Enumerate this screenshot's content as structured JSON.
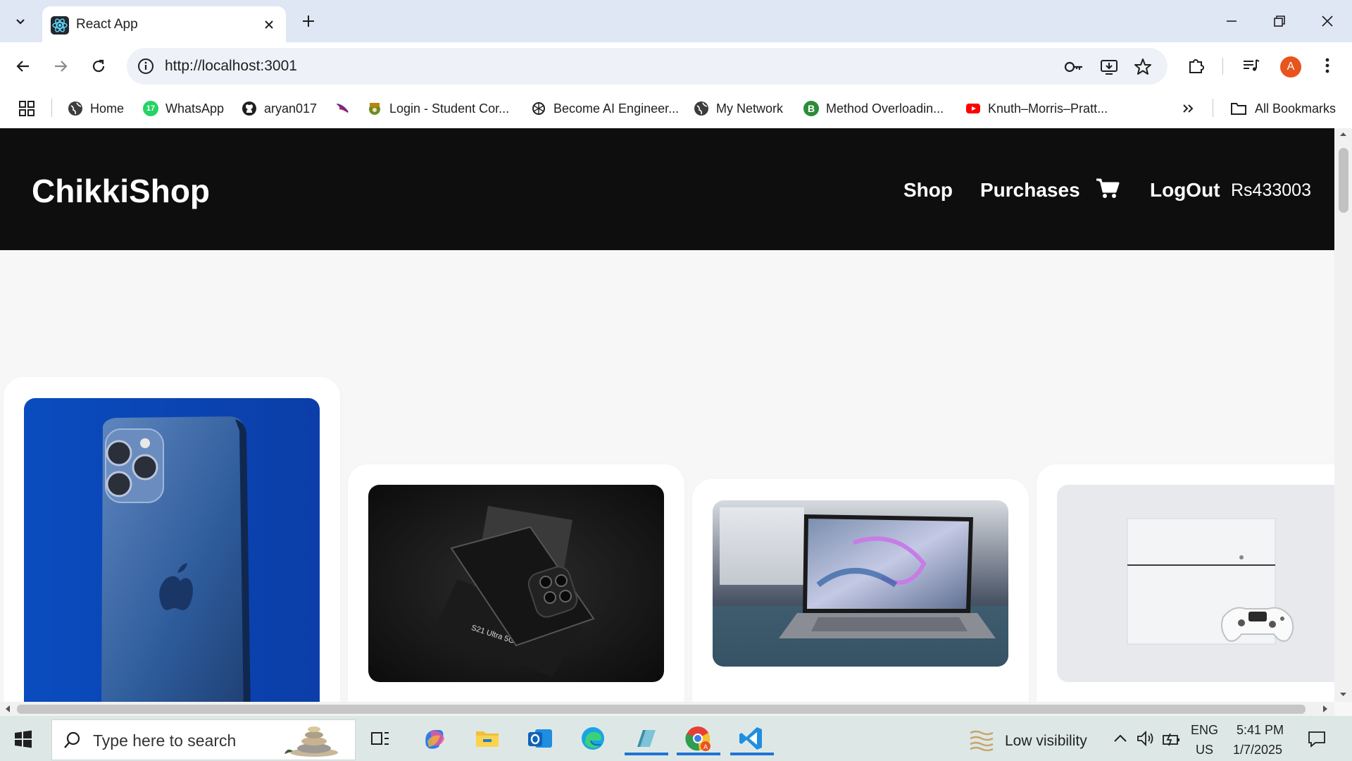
{
  "browser": {
    "tab_title": "React App",
    "url": "http://localhost:3001",
    "profile_initial": "A",
    "bookmarks": [
      {
        "label": "Home",
        "icon": "globe-icon"
      },
      {
        "label": "WhatsApp",
        "icon": "whatsapp-icon",
        "badge": "17"
      },
      {
        "label": "aryan017",
        "icon": "github-icon"
      },
      {
        "label": "",
        "icon": "bird-logo-icon"
      },
      {
        "label": "Login - Student Cor...",
        "icon": "student-portal-icon"
      },
      {
        "label": "Become AI Engineer...",
        "icon": "openai-icon"
      },
      {
        "label": "My Network",
        "icon": "globe-icon"
      },
      {
        "label": "Method Overloadin...",
        "icon": "b-logo-icon"
      },
      {
        "label": "Knuth–Morris–Pratt...",
        "icon": "youtube-icon"
      }
    ],
    "all_bookmarks_label": "All Bookmarks"
  },
  "app": {
    "brand": "ChikkiShop",
    "nav": {
      "shop": "Shop",
      "purchases": "Purchases",
      "cart_icon": "cart-icon",
      "logout": "LogOut",
      "balance": "Rs433003"
    },
    "products": [
      {
        "image": "iphone-blue-photo"
      },
      {
        "image": "samsung-s21-ultra-photo"
      },
      {
        "image": "laptop-photo"
      },
      {
        "image": "playstation-console-photo"
      }
    ]
  },
  "taskbar": {
    "search_placeholder": "Type here to search",
    "weather": "Low visibility",
    "lang_top": "ENG",
    "lang_bottom": "US",
    "time": "5:41 PM",
    "date": "1/7/2025"
  },
  "colors": {
    "navbar_bg": "#0e0e0e",
    "page_bg": "#f7f7f7",
    "chrome_bg": "#dfe7f5",
    "accent_taskbar": "#1f74d4"
  }
}
